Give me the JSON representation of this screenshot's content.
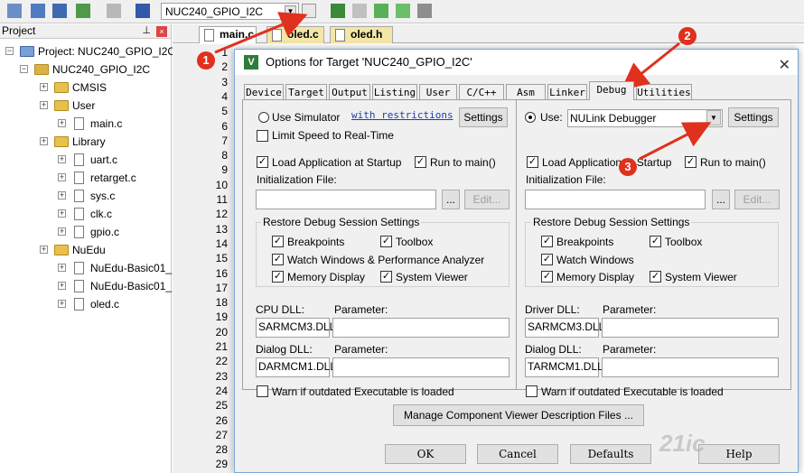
{
  "toolbar": {
    "target": "NUC240_GPIO_I2C",
    "icons": [
      "translate-icon",
      "build-icon",
      "rebuild-icon",
      "batch-build-icon",
      "stop-build-icon",
      "download-icon",
      "target-options-icon",
      "manage-project-icon",
      "file-extensions-icon",
      "books-icon",
      "packs-icon",
      "select-packs-icon"
    ]
  },
  "project_panel": {
    "title": "Project",
    "root": "Project: NUC240_GPIO_I2C",
    "target": "NUC240_GPIO_I2C",
    "groups": [
      {
        "name": "CMSIS",
        "files": []
      },
      {
        "name": "User",
        "files": [
          "main.c"
        ]
      },
      {
        "name": "Library",
        "files": [
          "uart.c",
          "retarget.c",
          "sys.c",
          "clk.c",
          "gpio.c"
        ]
      },
      {
        "name": "NuEdu",
        "files": [
          "NuEdu-Basic01_",
          "NuEdu-Basic01_",
          "oled.c"
        ]
      }
    ]
  },
  "editor": {
    "tabs": [
      "main.c",
      "oled.c",
      "oled.h"
    ],
    "line_numbers": [
      "1",
      "2",
      "3",
      "4",
      "5",
      "6",
      "7",
      "8",
      "9",
      "10",
      "11",
      "12",
      "13",
      "14",
      "15",
      "16",
      "17",
      "18",
      "19",
      "20",
      "21",
      "22",
      "23",
      "24",
      "25",
      "26",
      "27",
      "28",
      "29"
    ]
  },
  "dialog": {
    "title": "Options for Target 'NUC240_GPIO_I2C'",
    "tabs": [
      "Device",
      "Target",
      "Output",
      "Listing",
      "User",
      "C/C++",
      "Asm",
      "Linker",
      "Debug",
      "Utilities"
    ],
    "active_tab": "Debug",
    "left": {
      "use_simulator": "Use Simulator",
      "with_restrictions": "with restrictions",
      "settings": "Settings",
      "limit_speed": "Limit Speed to Real-Time",
      "load_app": "Load Application at Startup",
      "run_to_main": "Run to main()",
      "init_file": "Initialization File:",
      "browse": "...",
      "edit": "Edit...",
      "restore_title": "Restore Debug Session Settings",
      "breakpoints": "Breakpoints",
      "toolbox": "Toolbox",
      "watch_windows": "Watch Windows & Performance Analyzer",
      "memory_display": "Memory Display",
      "system_viewer": "System Viewer",
      "cpu_dll_label": "CPU DLL:",
      "cpu_param_label": "Parameter:",
      "cpu_dll": "SARMCM3.DLL",
      "dialog_dll_label": "Dialog DLL:",
      "dialog_param_label": "Parameter:",
      "dialog_dll": "DARMCM1.DLL",
      "warn": "Warn if outdated Executable is loaded"
    },
    "right": {
      "use": "Use:",
      "debugger": "NULink Debugger",
      "settings": "Settings",
      "load_app": "Load Application at Startup",
      "run_to_main": "Run to main()",
      "init_file": "Initialization File:",
      "browse": "...",
      "edit": "Edit...",
      "restore_title": "Restore Debug Session Settings",
      "breakpoints": "Breakpoints",
      "toolbox": "Toolbox",
      "watch_windows": "Watch Windows",
      "memory_display": "Memory Display",
      "system_viewer": "System Viewer",
      "driver_dll_label": "Driver DLL:",
      "driver_param_label": "Parameter:",
      "driver_dll": "SARMCM3.DLL",
      "dialog_dll_label": "Dialog DLL:",
      "dialog_param_label": "Parameter:",
      "dialog_dll": "TARMCM1.DLL",
      "warn": "Warn if outdated Executable is loaded"
    },
    "manage_btn": "Manage Component Viewer Description Files ...",
    "ok": "OK",
    "cancel": "Cancel",
    "defaults": "Defaults",
    "help": "Help"
  },
  "callouts": [
    "1",
    "2",
    "3"
  ],
  "watermark": "21ic",
  "colors": {
    "callout": "#e0301e",
    "arrow": "#e0301e",
    "folder": "#e8c04c"
  }
}
